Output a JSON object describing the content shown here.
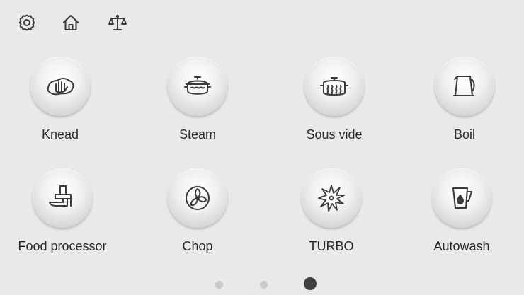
{
  "toolbar": {
    "icons": [
      "settings-icon",
      "home-icon",
      "scale-icon"
    ]
  },
  "modes": [
    {
      "label": "Knead",
      "icon": "knead-icon"
    },
    {
      "label": "Steam",
      "icon": "steam-icon"
    },
    {
      "label": "Sous vide",
      "icon": "sous-vide-icon"
    },
    {
      "label": "Boil",
      "icon": "kettle-icon"
    },
    {
      "label": "Food processor",
      "icon": "food-processor-icon"
    },
    {
      "label": "Chop",
      "icon": "chop-icon"
    },
    {
      "label": "TURBO",
      "icon": "turbo-icon"
    },
    {
      "label": "Autowash",
      "icon": "autowash-icon"
    }
  ],
  "pager": {
    "pages": 3,
    "current": 3
  },
  "colors": {
    "background": "#e9e9e9",
    "text": "#2a2a2a",
    "icon": "#3a3a3a",
    "dot_inactive": "#c9c9c9",
    "dot_active": "#404040"
  }
}
